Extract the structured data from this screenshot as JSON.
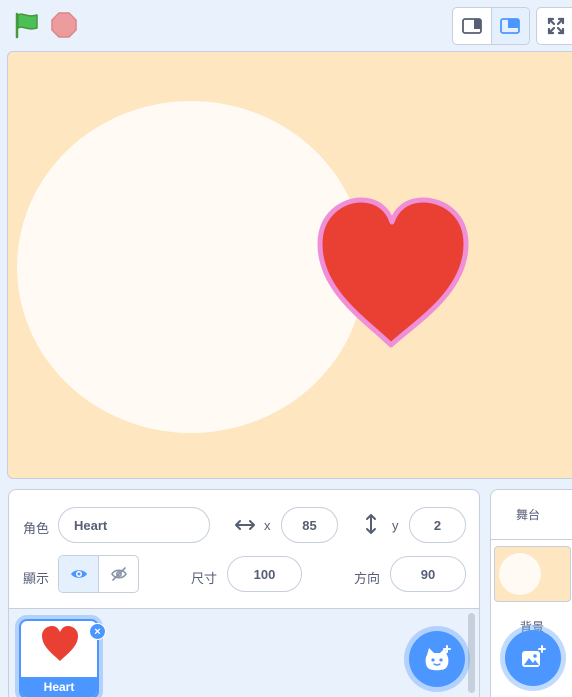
{
  "toolbar": {
    "green_flag_icon": "green-flag-icon",
    "stop_icon": "stop-sign-icon",
    "colors": {
      "flag": "#4cbf56",
      "stop": "#ec9c9c"
    }
  },
  "stage": {
    "background_color": "#fde6c0",
    "backdrop_circle_color": "#fffaf3",
    "sprite": {
      "fill": "#ea3f33",
      "outline": "#ee8fd8"
    }
  },
  "sprite_info": {
    "sprite_label": "角色",
    "sprite_name": "Heart",
    "x_label": "x",
    "x_value": "85",
    "y_label": "y",
    "y_value": "2",
    "show_label": "顯示",
    "size_label": "尺寸",
    "size_value": "100",
    "direction_label": "方向",
    "direction_value": "90"
  },
  "sprite_list": {
    "items": [
      {
        "name": "Heart",
        "selected": true
      }
    ]
  },
  "stage_selector": {
    "header": "舞台",
    "backdrops_label": "背景"
  },
  "colors": {
    "accent": "#4c97ff",
    "text": "#575e75",
    "border": "#c6cfdc"
  }
}
